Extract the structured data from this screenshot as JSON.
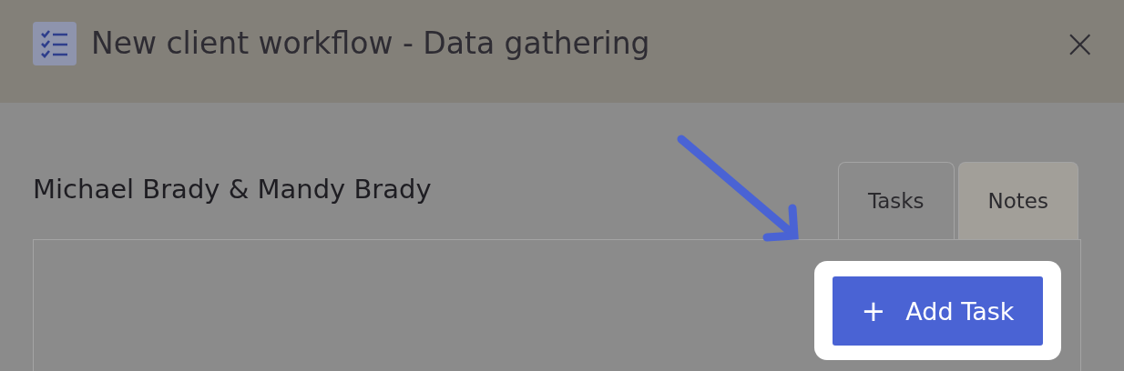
{
  "modal": {
    "title": "New client workflow - Data gathering",
    "close": "×"
  },
  "client_name": "Michael Brady & Mandy Brady",
  "tabs": [
    {
      "label": "Tasks",
      "selected": true
    },
    {
      "label": "Notes",
      "selected": false
    }
  ],
  "add_task_button": {
    "icon": "+",
    "label": "Add Task"
  }
}
